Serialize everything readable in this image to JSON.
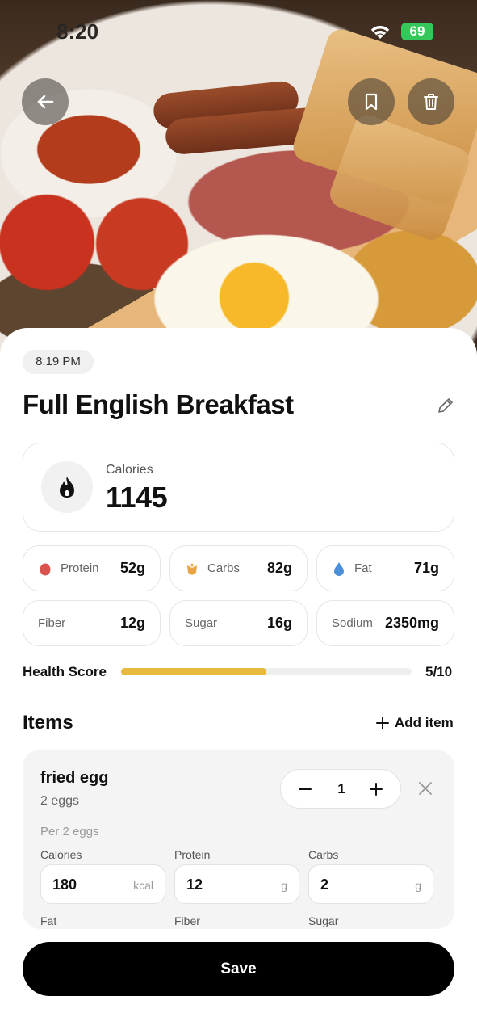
{
  "status_bar": {
    "time": "8:20",
    "battery": "69"
  },
  "meal": {
    "time": "8:19 PM",
    "title": "Full English Breakfast",
    "calories_label": "Calories",
    "calories_value": "1145"
  },
  "nutrients": [
    {
      "name": "Protein",
      "value": "52g",
      "icon": "protein-drop-icon",
      "color": "#d9534f"
    },
    {
      "name": "Carbs",
      "value": "82g",
      "icon": "wheat-icon",
      "color": "#e8a445"
    },
    {
      "name": "Fat",
      "value": "71g",
      "icon": "fat-drop-icon",
      "color": "#4a8fd8"
    },
    {
      "name": "Fiber",
      "value": "12g"
    },
    {
      "name": "Sugar",
      "value": "16g"
    },
    {
      "name": "Sodium",
      "value": "2350mg"
    }
  ],
  "health_score": {
    "label": "Health Score",
    "value": "5/10",
    "fraction": 0.5,
    "color": "#e9b93d"
  },
  "items_section": {
    "heading": "Items",
    "add_label": "Add item"
  },
  "item": {
    "name": "fried egg",
    "quantity_text": "2 eggs",
    "count": "1",
    "per_text": "Per 2 eggs",
    "fields": [
      {
        "label": "Calories",
        "value": "180",
        "unit": "kcal"
      },
      {
        "label": "Protein",
        "value": "12",
        "unit": "g"
      },
      {
        "label": "Carbs",
        "value": "2",
        "unit": "g"
      }
    ],
    "fields_row2": [
      {
        "label": "Fat"
      },
      {
        "label": "Fiber"
      },
      {
        "label": "Sugar"
      }
    ]
  },
  "save_label": "Save"
}
